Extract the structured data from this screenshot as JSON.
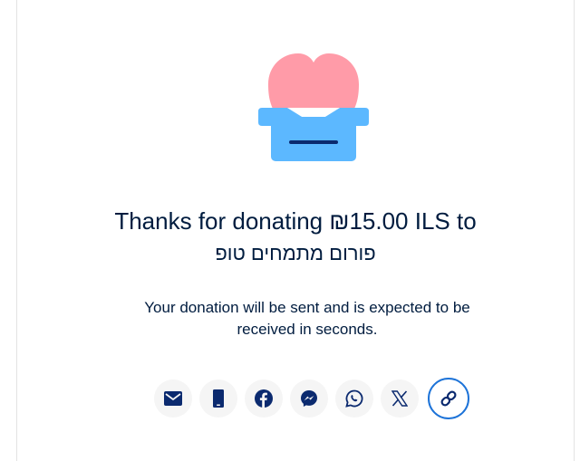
{
  "donation": {
    "title": "Thanks for donating ₪15.00 ILS to",
    "recipient": "פורום מתמחים טופ",
    "message": "Your donation will be sent and is expected to be received in seconds."
  },
  "colors": {
    "heart": "#ff9ba8",
    "box": "#5cb8ff",
    "slot": "#0b2a6f",
    "icon": "#0b2a6f",
    "focus_ring": "#1d73d8"
  },
  "share": {
    "icons": [
      "mail-icon",
      "phone-icon",
      "facebook-icon",
      "messenger-icon",
      "whatsapp-icon",
      "x-icon",
      "link-icon"
    ]
  }
}
